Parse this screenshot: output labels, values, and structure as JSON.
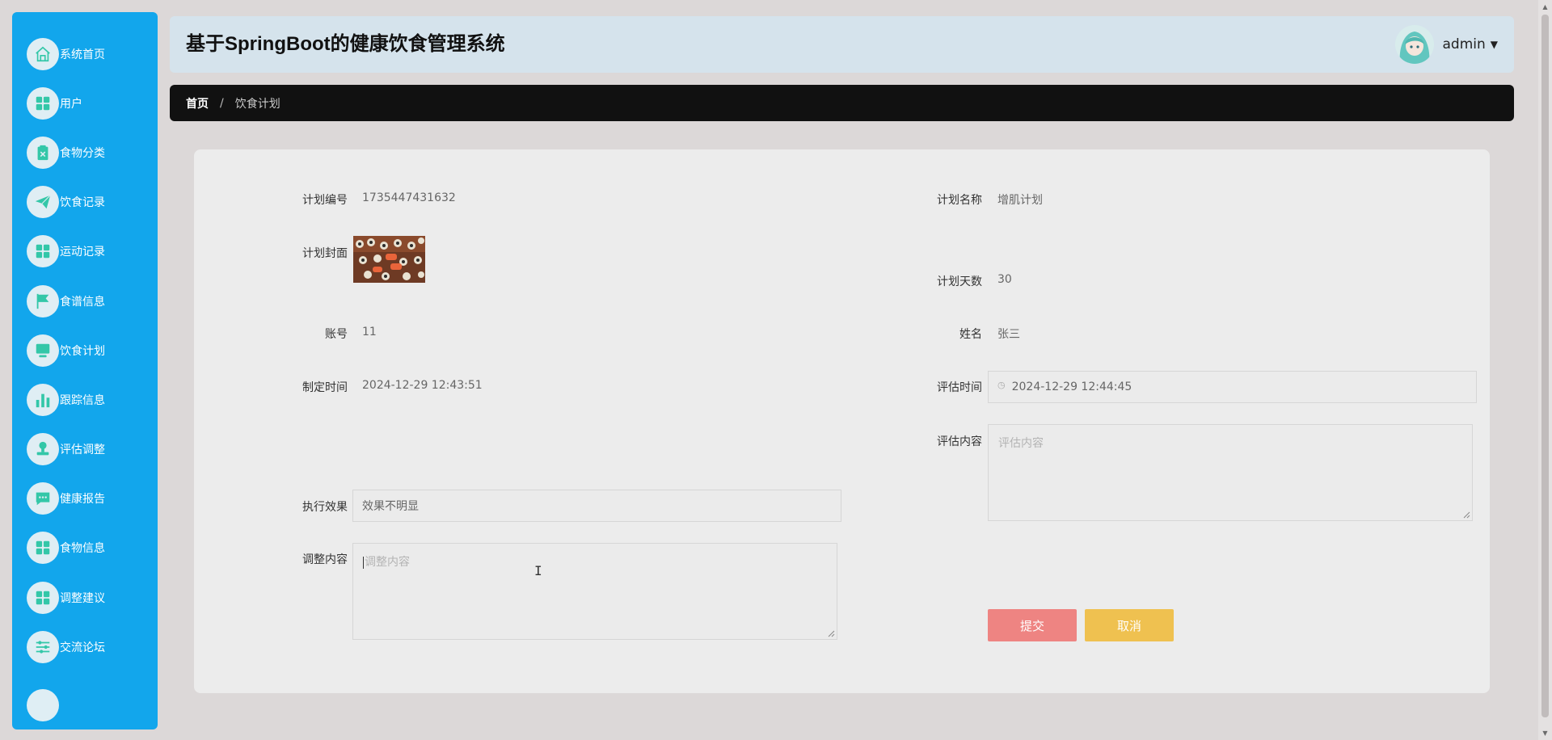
{
  "app": {
    "title": "基于SpringBoot的健康饮食管理系统"
  },
  "user": {
    "name": "admin"
  },
  "sidebar": {
    "items": [
      {
        "label": "系统首页",
        "icon": "home-icon"
      },
      {
        "label": "用户",
        "icon": "grid-icon"
      },
      {
        "label": "食物分类",
        "icon": "clipboard-icon"
      },
      {
        "label": "饮食记录",
        "icon": "paper-plane-icon"
      },
      {
        "label": "运动记录",
        "icon": "grid-icon"
      },
      {
        "label": "食谱信息",
        "icon": "flag-icon"
      },
      {
        "label": "饮食计划",
        "icon": "monitor-icon"
      },
      {
        "label": "跟踪信息",
        "icon": "bar-chart-icon"
      },
      {
        "label": "评估调整",
        "icon": "stamp-icon"
      },
      {
        "label": "健康报告",
        "icon": "chat-bubble-icon"
      },
      {
        "label": "食物信息",
        "icon": "grid-icon"
      },
      {
        "label": "调整建议",
        "icon": "grid-icon"
      },
      {
        "label": "交流论坛",
        "icon": "sliders-icon"
      }
    ]
  },
  "breadcrumb": {
    "home": "首页",
    "separator": "/",
    "current": "饮食计划"
  },
  "form": {
    "plan_no_label": "计划编号",
    "plan_no": "1735447431632",
    "plan_name_label": "计划名称",
    "plan_name": "增肌计划",
    "cover_label": "计划封面",
    "days_label": "计划天数",
    "days": "30",
    "account_label": "账号",
    "account": "11",
    "name_label": "姓名",
    "name": "张三",
    "created_label": "制定时间",
    "created": "2024-12-29 12:43:51",
    "eval_time_label": "评估时间",
    "eval_time": "2024-12-29 12:44:45",
    "eval_content_label": "评估内容",
    "eval_content_placeholder": "评估内容",
    "effect_label": "执行效果",
    "effect": "效果不明显",
    "adjust_label": "调整内容",
    "adjust_placeholder": "调整内容",
    "submit": "提交",
    "cancel": "取消"
  },
  "colors": {
    "sidebar": "#12a6ec",
    "header": "#d5e3ec",
    "breadcrumb": "#111111",
    "submit": "#ee8482",
    "cancel": "#efc150",
    "icon": "#33c7a8"
  }
}
